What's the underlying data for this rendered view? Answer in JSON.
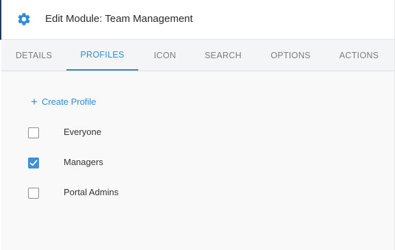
{
  "header": {
    "title": "Edit Module: Team Management",
    "icon": "gear-icon",
    "accent_color": "#2f8ad6"
  },
  "tabs": [
    {
      "label": "DETAILS",
      "active": false
    },
    {
      "label": "PROFILES",
      "active": true
    },
    {
      "label": "ICON",
      "active": false
    },
    {
      "label": "SEARCH",
      "active": false
    },
    {
      "label": "OPTIONS",
      "active": false
    },
    {
      "label": "ACTIONS",
      "active": false
    }
  ],
  "content": {
    "create_profile_label": "Create Profile",
    "create_profile_icon": "plus-icon",
    "profiles": [
      {
        "label": "Everyone",
        "checked": false
      },
      {
        "label": "Managers",
        "checked": true
      },
      {
        "label": "Portal Admins",
        "checked": false
      }
    ]
  }
}
